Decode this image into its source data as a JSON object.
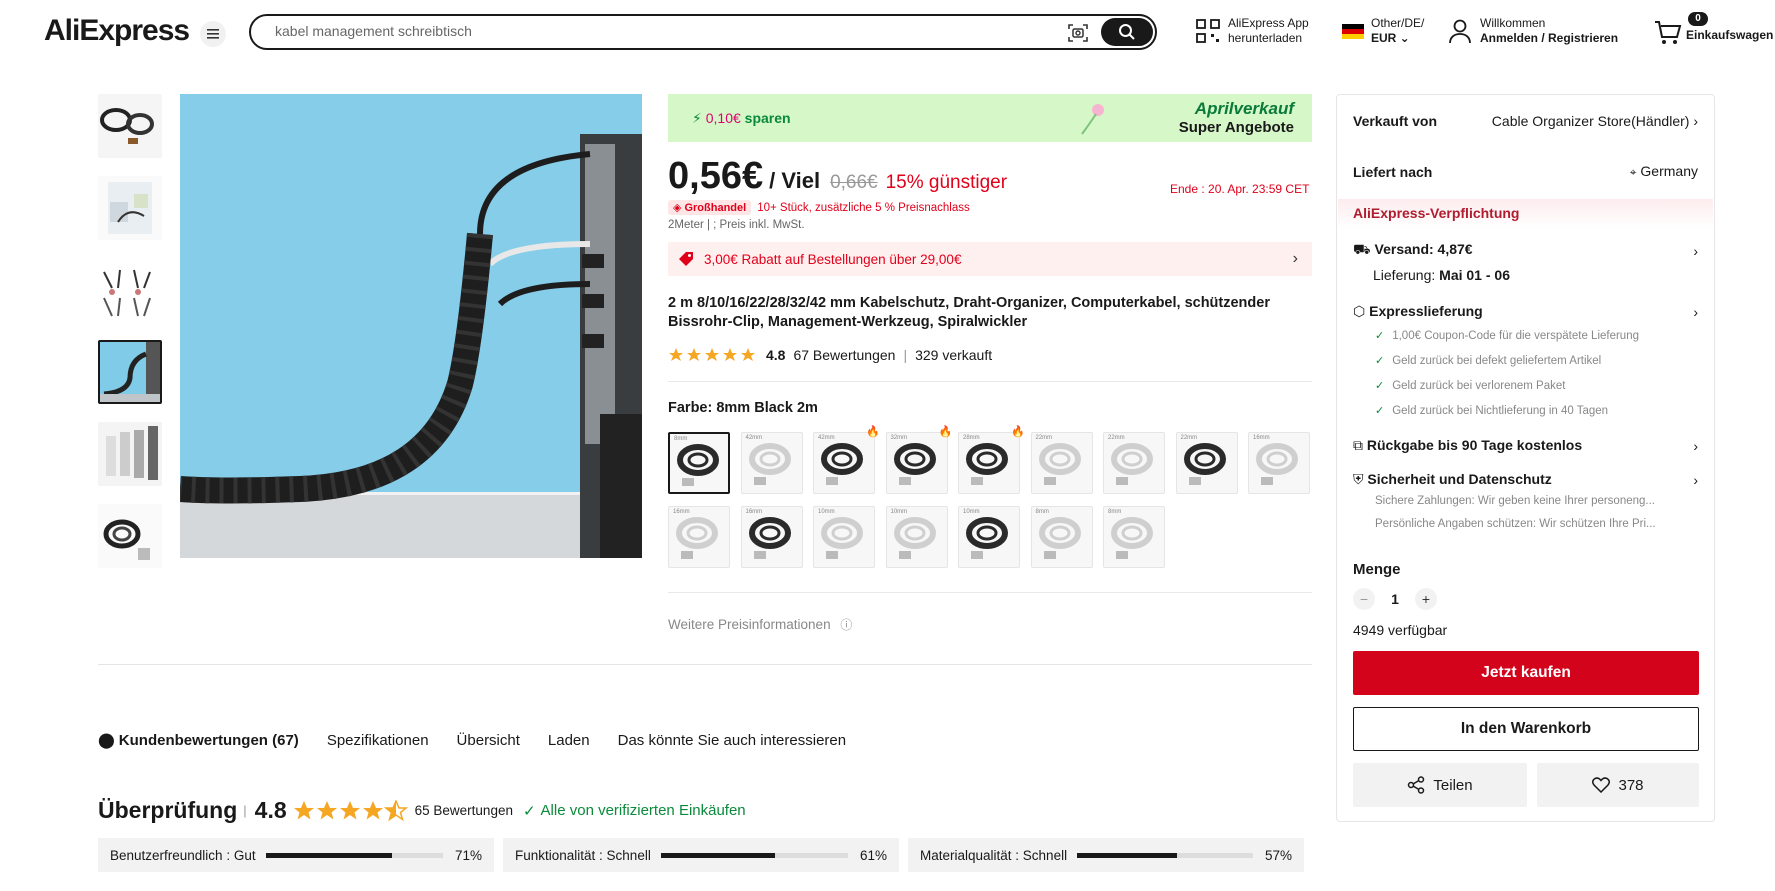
{
  "header": {
    "logo_text": "AliExpress",
    "search_value": "kabel management schreibtisch",
    "app_line1": "AliExpress App",
    "app_line2": "herunterladen",
    "region_line1": "Other/DE/",
    "region_line2": "EUR",
    "welcome_line1": "Willkommen",
    "welcome_line2": "Anmelden / Registrieren",
    "cart_count": "0",
    "cart_label": "Einkaufswagen"
  },
  "gallery": {
    "thumb_count": 6,
    "active_index": 3
  },
  "promo": {
    "save_amount": "0,10€",
    "save_label": "sparen",
    "event_title": "Aprilverkauf",
    "event_subtitle": "Super Angebote"
  },
  "price": {
    "current": "0,56€",
    "per": "/ Viel",
    "old": "0,66€",
    "discount": "15% günstiger",
    "ends": "Ende :  20. Apr. 23:59 CET",
    "wholesale_badge": "Großhandel",
    "wholesale_text": "10+ Stück, zusätzliche 5 % Preisnachlass",
    "unit_info": "2Meter | ; Preis inkl. MwSt."
  },
  "coupon": {
    "text": "3,00€ Rabatt auf Bestellungen über 29,00€"
  },
  "product": {
    "title": "2 m 8/10/16/22/28/32/42 mm Kabelschutz, Draht-Organizer, Computerkabel, schützender Bissrohr-Clip, Management-Werkzeug, Spiralwickler",
    "rating": "4.8",
    "reviews": "67 Bewertungen",
    "sold": "329 verkauft",
    "color_label": "Farbe: 8mm Black 2m",
    "more_price_info": "Weitere Preisinformationen"
  },
  "variants": [
    {
      "label": "8mm",
      "dark": true,
      "hot": false
    },
    {
      "label": "42mm",
      "dark": false,
      "hot": false
    },
    {
      "label": "42mm",
      "dark": true,
      "hot": true
    },
    {
      "label": "32mm",
      "dark": true,
      "hot": true
    },
    {
      "label": "28mm",
      "dark": true,
      "hot": true
    },
    {
      "label": "22mm",
      "dark": false,
      "hot": false
    },
    {
      "label": "22mm",
      "dark": false,
      "hot": false
    },
    {
      "label": "22mm",
      "dark": true,
      "hot": false
    },
    {
      "label": "16mm",
      "dark": false,
      "hot": false
    },
    {
      "label": "16mm",
      "dark": false,
      "hot": false
    },
    {
      "label": "16mm",
      "dark": true,
      "hot": false
    },
    {
      "label": "10mm",
      "dark": false,
      "hot": false
    },
    {
      "label": "10mm",
      "dark": false,
      "hot": false
    },
    {
      "label": "10mm",
      "dark": true,
      "hot": false
    },
    {
      "label": "8mm",
      "dark": false,
      "hot": false
    },
    {
      "label": "8mm",
      "dark": false,
      "hot": false
    }
  ],
  "sidebar": {
    "sold_by_label": "Verkauft von",
    "seller": "Cable Organizer Store(Händler)",
    "ship_to_label": "Liefert nach",
    "ship_to": "Germany",
    "commitment": "AliExpress-Verpflichtung",
    "shipping": "Versand: 4,87€",
    "delivery_label": "Lieferung:",
    "delivery_date": "Mai 01 - 06",
    "express": "Expresslieferung",
    "express_items": [
      "1,00€ Coupon-Code für die verspätete Lieferung",
      "Geld zurück bei defekt geliefertem Artikel",
      "Geld zurück bei verlorenem Paket",
      "Geld zurück bei Nichtlieferung in 40 Tagen"
    ],
    "returns": "Rückgabe bis 90 Tage kostenlos",
    "security": "Sicherheit und Datenschutz",
    "security_items": [
      "Sichere Zahlungen: Wir geben keine Ihrer personeng...",
      "Persönliche Angaben schützen: Wir schützen Ihre Pri..."
    ],
    "qty_label": "Menge",
    "qty_value": "1",
    "available": "4949 verfügbar",
    "buy_now": "Jetzt kaufen",
    "add_to_cart": "In den Warenkorb",
    "share": "Teilen",
    "wishlist_count": "378"
  },
  "tabs": [
    "Kundenbewertungen (67)",
    "Spezifikationen",
    "Übersicht",
    "Laden",
    "Das könnte Sie auch interessieren"
  ],
  "review_summary": {
    "heading": "Überprüfung",
    "score": "4.8",
    "count": "65 Bewertungen",
    "verified": "Alle von verifizierten Einkäufen",
    "metrics": [
      {
        "label": "Benutzerfreundlich : Gut",
        "percent": 71,
        "text": "71%"
      },
      {
        "label": "Funktionalität : Schnell",
        "percent": 61,
        "text": "61%"
      },
      {
        "label": "Materialqualität : Schnell",
        "percent": 57,
        "text": "57%"
      }
    ]
  },
  "colors": {
    "accent_red": "#d3031c",
    "green": "#0a8a3a",
    "star": "#f5a623"
  }
}
